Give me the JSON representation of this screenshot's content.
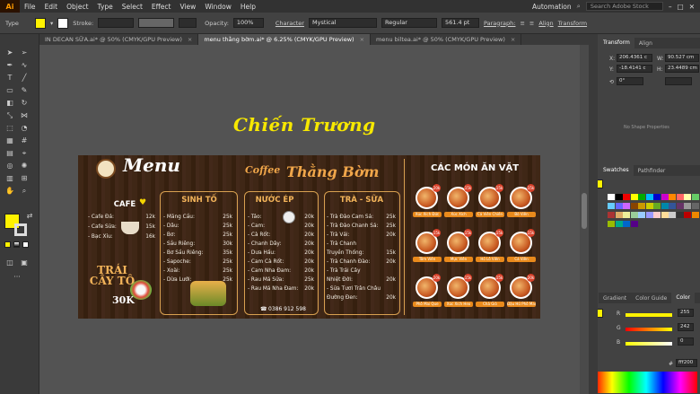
{
  "menubar": {
    "app_logo": "Ai",
    "items": [
      "File",
      "Edit",
      "Object",
      "Type",
      "Select",
      "Effect",
      "View",
      "Window",
      "Help"
    ],
    "workspace": "Automation",
    "search_placeholder": "Search Adobe Stock"
  },
  "control_bar": {
    "selection_label": "Type",
    "fill_color": "#ffff00",
    "stroke_label": "Stroke:",
    "opacity_label": "Opacity:",
    "opacity_value": "100%",
    "char_label": "Character",
    "font_family": "Mystical",
    "font_style": "Regular",
    "font_size": "561.4 pt",
    "paragraph_label": "Paragraph:",
    "align_label": "Align",
    "transform_label": "Transform"
  },
  "tabs": [
    {
      "label": "IN DECAN SỮA.ai* @ 50% (CMYK/GPU Preview)",
      "active": false
    },
    {
      "label": "menu thằng bờm.ai* @ 6.25% (CMYK/GPU Preview)",
      "active": true
    },
    {
      "label": "menu biltea.ai* @ 50% (CMYK/GPU Preview)",
      "active": false
    }
  ],
  "canvas": {
    "signature_text": "Chiến Trương"
  },
  "menu_board": {
    "logo_text": "Menu",
    "brand_small": "Coffee",
    "brand_big": "Thằng Bờm",
    "sections": {
      "cafe": {
        "title": "CAFE",
        "items": [
          {
            "name": "- Cafe Đá:",
            "price": "12k"
          },
          {
            "name": "- Cafe Sữa:",
            "price": "15k"
          },
          {
            "name": "- Bạc Xỉu:",
            "price": "16k"
          }
        ]
      },
      "trai_cay": {
        "title": "TRÁI CÂY TÔ",
        "price": "30K"
      },
      "sinh_to": {
        "title": "SINH TỐ",
        "items": [
          {
            "name": "- Mãng Cầu:",
            "price": "25k"
          },
          {
            "name": "- Dâu:",
            "price": "25k"
          },
          {
            "name": "- Bơ:",
            "price": "25k"
          },
          {
            "name": "- Sầu Riêng:",
            "price": "30k"
          },
          {
            "name": "- Bơ Sầu Riêng:",
            "price": "35k"
          },
          {
            "name": "- Sapoche:",
            "price": "25k"
          },
          {
            "name": "- Xoài:",
            "price": "25k"
          },
          {
            "name": "- Dừa Lưới:",
            "price": "25k"
          }
        ]
      },
      "nuoc_ep": {
        "title": "NƯỚC ÉP",
        "items": [
          {
            "name": "- Táo:",
            "price": "20k"
          },
          {
            "name": "- Cam:",
            "price": "20k"
          },
          {
            "name": "- Cà Rốt:",
            "price": "20k"
          },
          {
            "name": "- Chanh Dây:",
            "price": "20k"
          },
          {
            "name": "- Dưa Hấu:",
            "price": "20k"
          },
          {
            "name": "- Cam Cà Rốt:",
            "price": "20k"
          },
          {
            "name": "- Cam Nha Đam:",
            "price": "20k"
          },
          {
            "name": "- Rau Má Sữa:",
            "price": "25k"
          },
          {
            "name": "- Rau Má Nha Đam:",
            "price": "20k"
          }
        ],
        "phone": "0386 912 598"
      },
      "tra_sua": {
        "title": "TRÀ - SỮA",
        "items": [
          {
            "name": "- Trà Đào Cam Sả:",
            "price": "25k"
          },
          {
            "name": "- Trà Đào Chanh Sả:",
            "price": "25k"
          },
          {
            "name": "- Trà Vải:",
            "price": "20k"
          },
          {
            "name": "- Trà Chanh",
            "price": ""
          },
          {
            "name": "  Truyền Thống:",
            "price": "15k"
          },
          {
            "name": "- Trà Chanh Đào:",
            "price": "20k"
          },
          {
            "name": "- Trà Trái Cây",
            "price": ""
          },
          {
            "name": "  Nhiệt Đới:",
            "price": "20k"
          },
          {
            "name": "- Sữa Tươi Trân Châu",
            "price": ""
          },
          {
            "name": "  Đường Đen:",
            "price": "20k"
          }
        ]
      },
      "an_vat": {
        "title": "CÁC MÓN ĂN VẶT",
        "foods": [
          {
            "label": "Xúc Xích Đức",
            "price": "20k"
          },
          {
            "label": "Xúc Xích",
            "price": "15k"
          },
          {
            "label": "Cá Viên Chiên",
            "price": "15k"
          },
          {
            "label": "Bò Viên",
            "price": "15k"
          },
          {
            "label": "Tôm Viên",
            "price": "15k"
          },
          {
            "label": "Mực Viên",
            "price": "15k"
          },
          {
            "label": "Hồ Lô Viên",
            "price": "15k"
          },
          {
            "label": "Cá Viên",
            "price": "15k"
          },
          {
            "label": "Phô Mai Que",
            "price": "20k"
          },
          {
            "label": "Xúc Xích Heo",
            "price": "15k"
          },
          {
            "label": "Chả Giò",
            "price": "15k"
          },
          {
            "label": "Đậu Hũ Phô Mai",
            "price": "20k"
          }
        ]
      }
    }
  },
  "right_panel": {
    "tabs1": [
      "Transform",
      "Align"
    ],
    "x_label": "X:",
    "x_value": "206.4361 c",
    "y_label": "Y:",
    "y_value": "-18.4141 c",
    "w_label": "W:",
    "w_value": "90.527 cm",
    "h_label": "H:",
    "h_value": "23.4489 cm",
    "rotate_value": "0°",
    "no_shape": "No Shape Properties",
    "tabs2": [
      "Swatches",
      "Pathfinder"
    ],
    "tabs3": [
      "Gradient",
      "Color Guide",
      "Color"
    ],
    "r_label": "R",
    "r_value": "255",
    "g_label": "G",
    "g_value": "242",
    "b_label": "B",
    "b_value": "0",
    "hex_value": "fff200"
  }
}
